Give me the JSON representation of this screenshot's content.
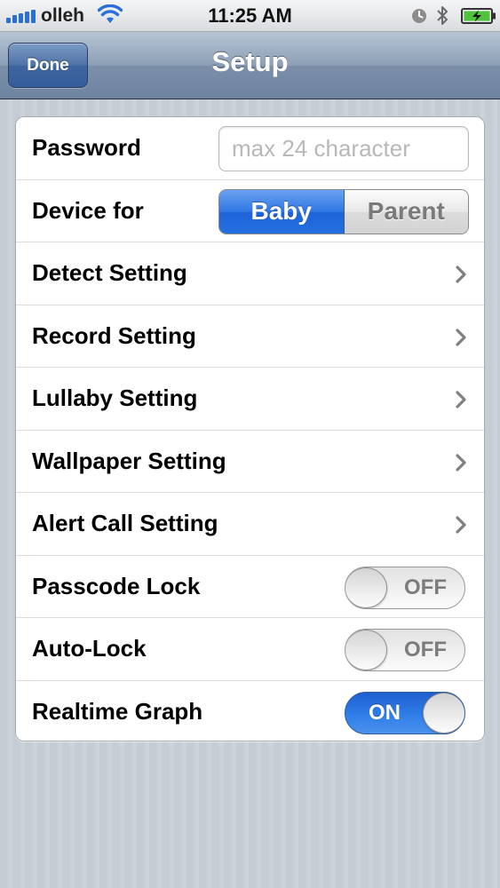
{
  "status_bar": {
    "carrier": "olleh",
    "time": "11:25 AM",
    "icons": [
      "signal-icon",
      "wifi-icon",
      "alarm-clock-icon",
      "bluetooth-icon",
      "battery-charging-icon"
    ]
  },
  "navbar": {
    "done_label": "Done",
    "title": "Setup"
  },
  "settings": {
    "password": {
      "label": "Password",
      "placeholder": "max 24 character",
      "value": ""
    },
    "device_for": {
      "label": "Device for",
      "options": [
        "Baby",
        "Parent"
      ],
      "selected": "Baby"
    },
    "detect": {
      "label": "Detect Setting"
    },
    "record": {
      "label": "Record Setting"
    },
    "lullaby": {
      "label": "Lullaby Setting"
    },
    "wallpaper": {
      "label": "Wallpaper Setting"
    },
    "alert_call": {
      "label": "Alert Call Setting"
    },
    "passcode_lock": {
      "label": "Passcode Lock",
      "state": "OFF"
    },
    "auto_lock": {
      "label": "Auto-Lock",
      "state": "OFF"
    },
    "realtime_graph": {
      "label": "Realtime Graph",
      "state": "ON"
    }
  },
  "colors": {
    "accent_blue": "#2f76e3",
    "nav_bar": "#8d9fb6",
    "background": "#c5ccd4"
  }
}
